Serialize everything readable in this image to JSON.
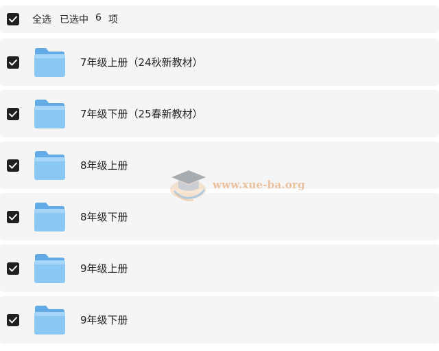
{
  "header": {
    "select_all_label": "全选",
    "selected_prefix": "已选中",
    "selected_count": "6",
    "selected_suffix": "项"
  },
  "items": [
    {
      "name": "7年级上册（24秋新教材）",
      "checked": true
    },
    {
      "name": "7年级下册（25春新教材）",
      "checked": true
    },
    {
      "name": "8年级上册",
      "checked": true
    },
    {
      "name": "8年级下册",
      "checked": true
    },
    {
      "name": "9年级上册",
      "checked": true
    },
    {
      "name": "9年级下册",
      "checked": true
    }
  ],
  "watermark": {
    "text": "www.xue-ba.org"
  },
  "colors": {
    "row_bg": "#f5f5f6",
    "checkbox": "#1f1f1f",
    "folder_front": "#8cc8f4",
    "folder_back": "#62abe7"
  },
  "icons": {
    "checkbox": "checkmark-icon",
    "folder": "folder-icon",
    "watermark_logo": "graduation-cap-icon"
  }
}
